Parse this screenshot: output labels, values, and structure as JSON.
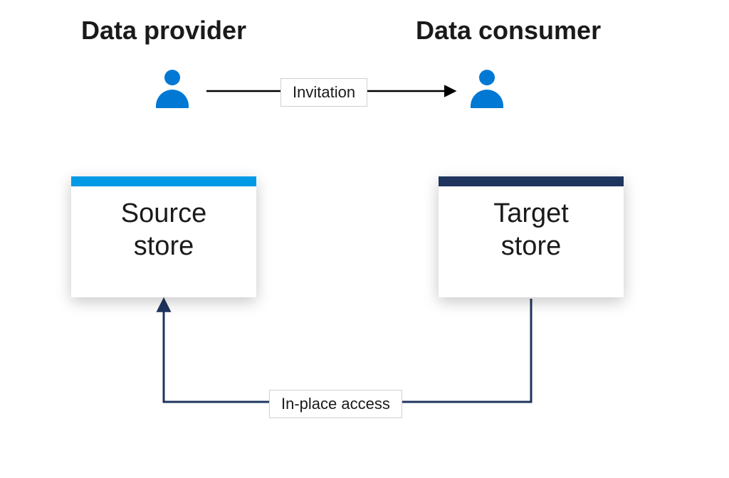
{
  "titles": {
    "provider": "Data provider",
    "consumer": "Data consumer"
  },
  "actors": {
    "provider_icon": "user-icon",
    "consumer_icon": "user-icon"
  },
  "stores": {
    "source": {
      "line1": "Source",
      "line2": "store",
      "accent": "#0099e6"
    },
    "target": {
      "line1": "Target",
      "line2": "store",
      "accent": "#1f355e"
    }
  },
  "arrows": {
    "invitation": "Invitation",
    "access": "In-place access"
  },
  "colors": {
    "person": "#0078d4",
    "arrow_black": "#000000",
    "arrow_navy": "#1f355e"
  }
}
